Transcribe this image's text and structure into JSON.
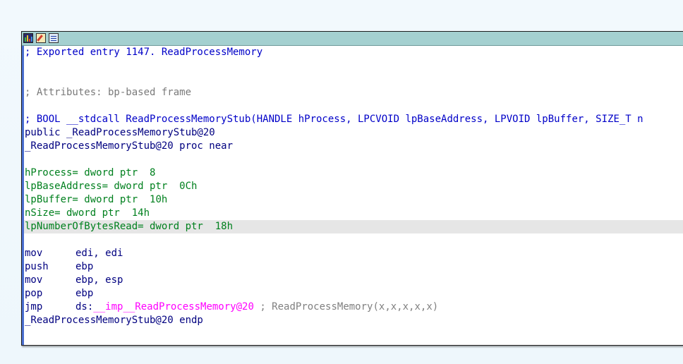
{
  "toolbar": {
    "icons": [
      "graph-view-icon",
      "edit-icon",
      "hex-view-icon"
    ]
  },
  "disasm": {
    "comment_export": "; Exported entry 1147. ReadProcessMemory",
    "comment_attrs": "; Attributes: bp-based frame",
    "comment_proto": "; BOOL __stdcall ReadProcessMemoryStub(HANDLE hProcess, LPCVOID lpBaseAddress, LPVOID lpBuffer, SIZE_T n",
    "public_line": "public _ReadProcessMemoryStub@20",
    "proc_line": "_ReadProcessMemoryStub@20 proc near",
    "vars": [
      {
        "name": "hProcess= dword ptr",
        "value": "8"
      },
      {
        "name": "lpBaseAddress= dword ptr",
        "value": "0Ch"
      },
      {
        "name": "lpBuffer= dword ptr",
        "value": "10h"
      },
      {
        "name": "nSize= dword ptr",
        "value": "14h"
      },
      {
        "name": "lpNumberOfBytesRead= dword ptr",
        "value": "18h"
      }
    ],
    "instructions": [
      {
        "mnemonic": "mov",
        "operands": "edi, edi"
      },
      {
        "mnemonic": "push",
        "operands": "ebp"
      },
      {
        "mnemonic": "mov",
        "operands": "ebp, esp"
      },
      {
        "mnemonic": "pop",
        "operands": "ebp"
      }
    ],
    "jmp": {
      "mnemonic": "jmp",
      "prefix": "ds:",
      "target": "__imp__ReadProcessMemory@20",
      "comment": "; ReadProcessMemory(x,x,x,x,x)"
    },
    "endp_line": "_ReadProcessMemoryStub@20 endp"
  },
  "colors": {
    "titlebar": "#a4d0d0",
    "highlight_row": "#e6e6e6",
    "code_blue": "#0000ff",
    "number_green": "#00801e",
    "import_pink": "#ff00ff",
    "comment_gray": "#7a7a7a"
  }
}
